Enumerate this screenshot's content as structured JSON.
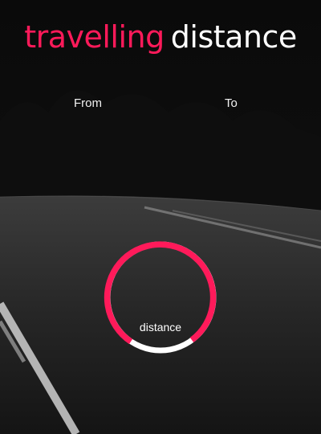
{
  "header": {
    "title_accent": "travelling",
    "title_rest": "distance"
  },
  "form": {
    "from_label": "From",
    "to_label": "To"
  },
  "gauge": {
    "label": "distance",
    "progress_color": "#ff1a5a",
    "track_color": "#ffffff"
  },
  "colors": {
    "accent": "#ff1a5a",
    "background": "#050505",
    "text": "#ffffff"
  }
}
